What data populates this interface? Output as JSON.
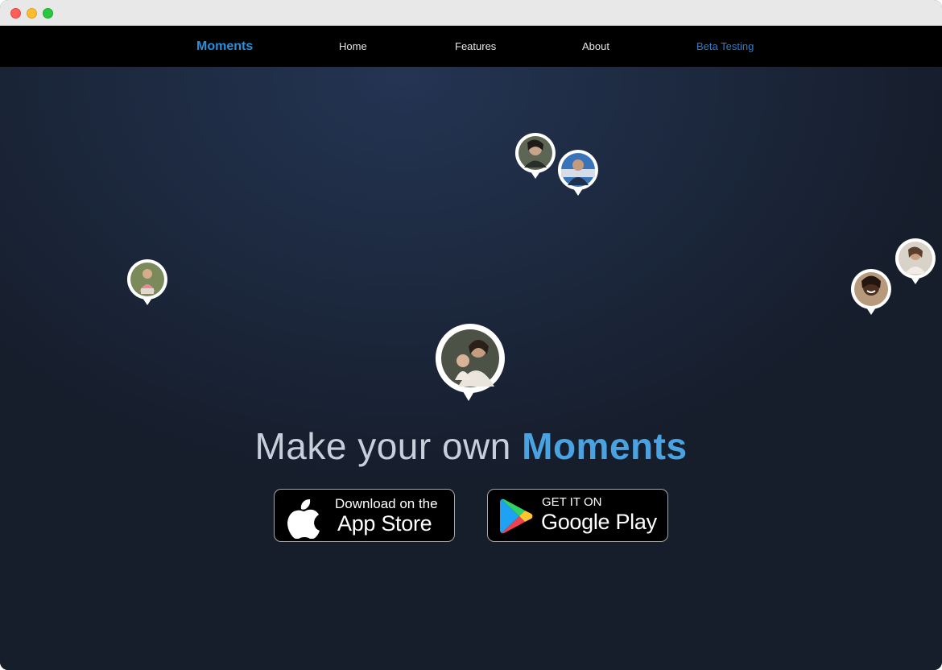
{
  "nav": {
    "brand": "Moments",
    "home": "Home",
    "features": "Features",
    "about": "About",
    "beta": "Beta Testing"
  },
  "hero": {
    "headline_prefix": "Make your own",
    "headline_accent": "Moments"
  },
  "appstore": {
    "small": "Download on the",
    "big": "App Store"
  },
  "googleplay": {
    "small": "GET IT ON",
    "big": "Google Play"
  },
  "colors": {
    "brand": "#2a8fd8",
    "accent": "#4aa3e0",
    "background": "#1a2233"
  }
}
